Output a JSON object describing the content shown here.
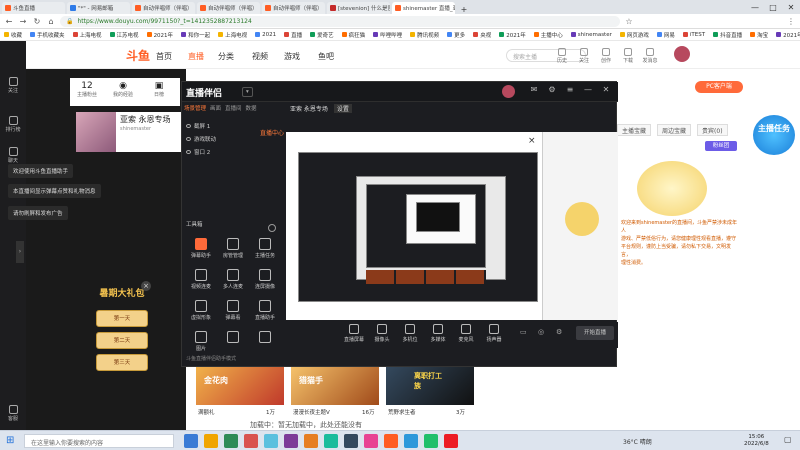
{
  "browser": {
    "tabs": [
      {
        "label": "斗鱼直播",
        "color": "#ff5d23",
        "active": false
      },
      {
        "label": "\"*\" - 网易邮箱",
        "color": "#2e7be8",
        "active": false
      },
      {
        "label": "自动伴唱师（伴唱）",
        "color": "#ff5d23",
        "active": false
      },
      {
        "label": "自动伴唱师（伴唱）",
        "color": "#ff5d23",
        "active": false
      },
      {
        "label": "自动伴唱师（伴唱）",
        "color": "#ff5d23",
        "active": false
      },
      {
        "label": "[stevenion] 什么是官网",
        "color": "#c42a2a",
        "active": false
      },
      {
        "label": "shinemaster 直播_亚索",
        "color": "#ff5d23",
        "active": true
      }
    ],
    "url": "https://www.douyu.com/9971150?_t=1412352887213124",
    "bookmarks": [
      "收藏",
      "手机收藏夹",
      "上海电视",
      "江苏电视",
      "2021年",
      "和你一起",
      "上海电视",
      "2021",
      "直播",
      "爱奇艺",
      "疯狂猫",
      "哔哩哔哩",
      "腾讯视频",
      "更多",
      "央视",
      "2021年",
      "主播中心",
      "shinemaster",
      "网页游戏",
      "网易",
      "iTEST",
      "抖音直播",
      "淘宝",
      "2021年",
      "超值",
      "更多",
      "教程"
    ],
    "window_controls": [
      "—",
      "□",
      "✕"
    ]
  },
  "douyu": {
    "logo": "斗鱼",
    "nav": [
      "首页",
      "直播",
      "分类",
      "视频",
      "游戏",
      "鱼吧"
    ],
    "search_placeholder": "搜索主播",
    "header_icons": [
      "历史",
      "关注",
      "创作",
      "下载",
      "发消息",
      "个人"
    ],
    "left_sidebar": [
      "关注",
      "排行榜",
      "聊天",
      "客服"
    ],
    "stats": [
      {
        "num": "12",
        "label": "主播粉丝"
      },
      {
        "num": "",
        "label": "我的经验"
      },
      {
        "num": "",
        "label": "日榜"
      }
    ],
    "room_title": "亚索 永恩专场",
    "room_host": "shinemaster",
    "toasts": [
      "欢迎使用斗鱼直播助手",
      "本直播间显示弹幕点赞和礼物消息",
      "请勿刷屏和发布广告"
    ],
    "promo": {
      "title": "暑期大礼包",
      "days": [
        "第一天",
        "第二天",
        "第三天"
      ]
    }
  },
  "app": {
    "title": "直播伴侣",
    "tabs_left": [
      "场景管理",
      "画面",
      "直播间",
      "数据"
    ],
    "tabs_main": [
      "亚索 永恩专场",
      "设置"
    ],
    "sources": [
      "截屏 1",
      "游戏联动",
      "窗口 2"
    ],
    "center_link": "直播中心",
    "tools_label": "工具箱",
    "tools": [
      "弹幕助手",
      "房管管理",
      "主播任务",
      "视频连麦",
      "多人连麦",
      "连屏摄像",
      "虚拟形象",
      "弹幕看",
      "直播助手",
      "图片",
      "",
      ""
    ],
    "controls": [
      "直播屏幕",
      "摄像头",
      "多机位",
      "多媒体",
      "麦克风",
      "扬声器"
    ],
    "start_button": "开始直播",
    "status": "斗鱼直播伴侣助手模式"
  },
  "right": {
    "pc_button": "PC客户端",
    "tabs": [
      "主播宝藏",
      "周边宝藏",
      "贵宾(0)"
    ],
    "fan_label": "粉丝团",
    "text_lines": [
      "欢迎来到shinemaster的直播间，斗鱼严禁涉未成年人",
      "游戏、严禁低俗行为，请您健康理性观看直播，遵守",
      "平台规则，谨防上当受骗，请勿私下交易，文明发言，",
      "理性消费。"
    ],
    "quest_badge": "主播任务"
  },
  "thumbnails": [
    {
      "caption": "满额礼",
      "color": "#c0392b",
      "title": "金花肉"
    },
    {
      "caption": "漫漫长夜主题V",
      "color": "#d68a2a",
      "title": "猎猫手"
    },
    {
      "caption": "荒野求生者",
      "color": "#2c3e50",
      "title": "离职打工族"
    }
  ],
  "thumb_counts": [
    "1万",
    "16万",
    "3万"
  ],
  "bottom_text": "加载中：暂无加载中，此处还能没有",
  "taskbar": {
    "search_placeholder": "在这里输入你要搜索的内容",
    "weather": "36°C 晴朗",
    "time": "15:06",
    "date": "2022/6/8"
  }
}
